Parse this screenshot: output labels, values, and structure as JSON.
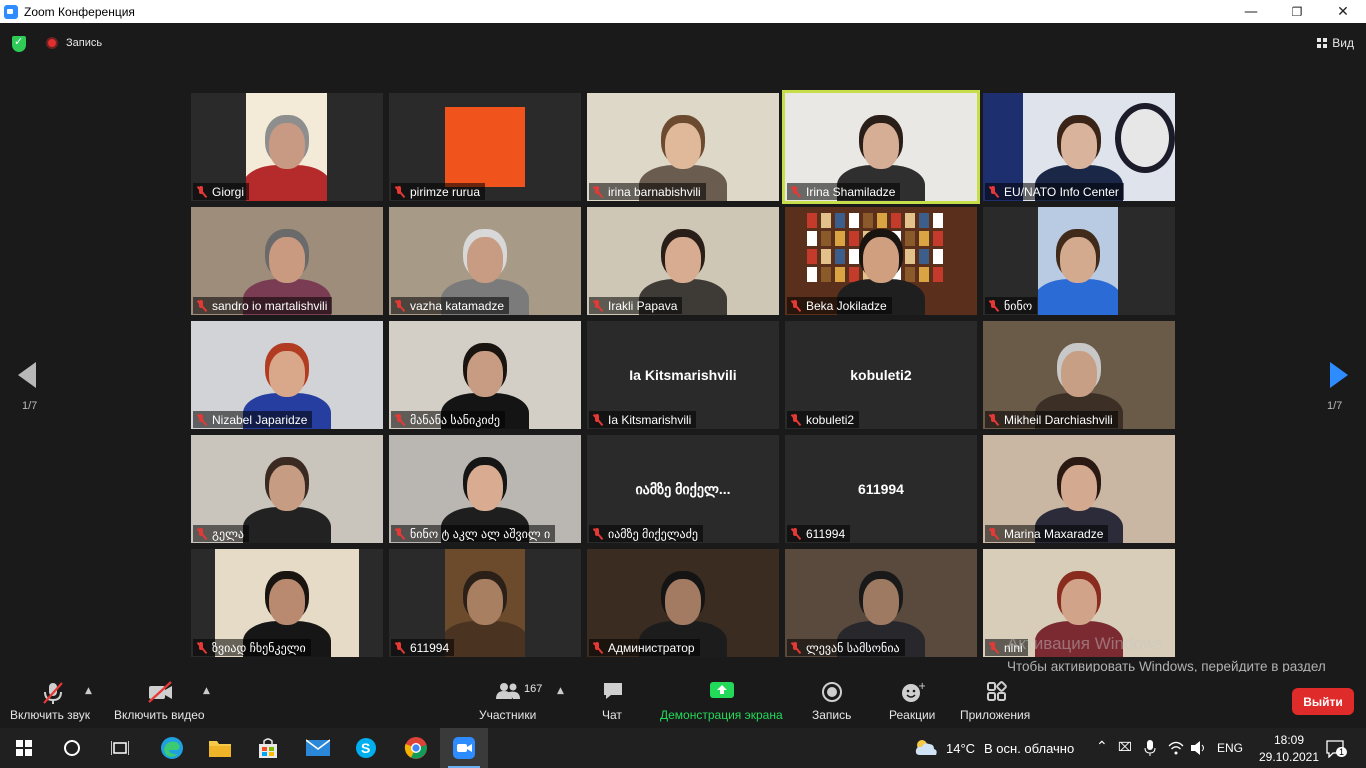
{
  "window": {
    "title": "Zoom Конференция",
    "minimize": "—",
    "restore": "❐",
    "close": "✕"
  },
  "topbar": {
    "recording_label": "Запись",
    "view_label": "Вид"
  },
  "pagination": {
    "left": "1/7",
    "right": "1/7"
  },
  "tiles": [
    {
      "name": "Giorgi",
      "video": true,
      "active": false
    },
    {
      "name": "pirimze rurua",
      "video": true,
      "active": false
    },
    {
      "name": "irina barnabishvili",
      "video": true,
      "active": false
    },
    {
      "name": "Irina Shamiladze",
      "video": true,
      "active": true
    },
    {
      "name": "EU/NATO Info Center",
      "video": true,
      "active": false
    },
    {
      "name": "sandro io martalishvili",
      "video": true,
      "active": false
    },
    {
      "name": "vazha katamadze",
      "video": true,
      "active": false
    },
    {
      "name": "Irakli Papava",
      "video": true,
      "active": false
    },
    {
      "name": "Beka Jokiladze",
      "video": true,
      "active": false
    },
    {
      "name": "ნინო",
      "video": true,
      "active": false
    },
    {
      "name": "Nizabel Japaridze",
      "video": true,
      "active": false
    },
    {
      "name": "მანანა სანიკიძე",
      "video": true,
      "active": false
    },
    {
      "name": "Ia Kitsmarishvili",
      "video": false,
      "display": "Ia Kitsmarishvili",
      "active": false
    },
    {
      "name": "kobuleti2",
      "video": false,
      "display": "kobuleti2",
      "active": false
    },
    {
      "name": "Mikheil Darchiashvili",
      "video": true,
      "active": false
    },
    {
      "name": "გელა",
      "video": true,
      "active": false
    },
    {
      "name": "ნინო ტ აკლ ალ აშვილ ი",
      "video": true,
      "active": false
    },
    {
      "name": "იამზე მიქელაძე",
      "video": false,
      "display": "იამზე მიქელ...",
      "active": false
    },
    {
      "name": "611994",
      "video": false,
      "display": "611994",
      "active": false
    },
    {
      "name": "Marina Maxaradze",
      "video": true,
      "active": false
    },
    {
      "name": "ზვიად ჩხენკელი",
      "video": true,
      "active": false
    },
    {
      "name": "611994",
      "video": true,
      "active": false
    },
    {
      "name": "Администратор",
      "video": true,
      "active": false
    },
    {
      "name": "ლევან სამსონია",
      "video": true,
      "active": false
    },
    {
      "name": "nini",
      "video": true,
      "active": false
    }
  ],
  "toolbar": {
    "audio_label": "Включить звук",
    "video_label": "Включить видео",
    "participants_label": "Участники",
    "participants_count": "167",
    "chat_label": "Чат",
    "share_label": "Демонстрация экрана",
    "record_label": "Запись",
    "reactions_label": "Реакции",
    "apps_label": "Приложения",
    "leave_label": "Выйти"
  },
  "watermark": {
    "line1": "Активация Windows",
    "line2": "Чтобы активировать Windows, перейдите в раздел \"Параметры\"."
  },
  "taskbar": {
    "weather_temp": "14°C",
    "weather_desc": "В осн. облачно",
    "lang": "ENG",
    "time": "18:09",
    "date": "29.10.2021",
    "notifications": "1"
  },
  "colors": {
    "accent": "#2d8cff",
    "active_speaker": "#c7dd4a",
    "leave": "#e02b2b",
    "share": "#23d959",
    "mute": "#e53935"
  }
}
